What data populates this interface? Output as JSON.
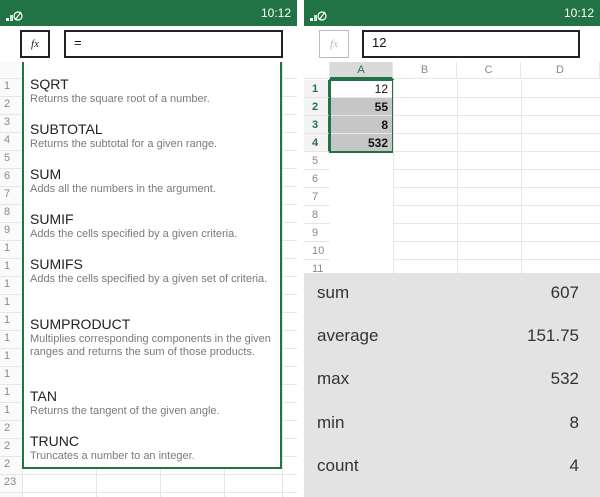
{
  "left": {
    "time": "10:12",
    "fx_label": "fx",
    "formula_value": "=",
    "row_numbers": [
      "1",
      "2",
      "3",
      "4",
      "5",
      "6",
      "7",
      "8",
      "9",
      "1",
      "1",
      "1",
      "1",
      "1",
      "1",
      "1",
      "1",
      "1",
      "1",
      "2",
      "2",
      "2",
      "23"
    ],
    "functions": [
      {
        "name": "SQRT",
        "description": "Returns the square root of a number."
      },
      {
        "name": "SUBTOTAL",
        "description": "Returns the subtotal for a given range."
      },
      {
        "name": "SUM",
        "description": "Adds all the numbers in the argument."
      },
      {
        "name": "SUMIF",
        "description": "Adds the cells specified by a given criteria."
      },
      {
        "name": "SUMIFS",
        "description": "Adds the cells specified by a given set of criteria."
      },
      {
        "name": "SUMPRODUCT",
        "description": "Multiplies corresponding components in the given ranges and returns the sum of those products."
      },
      {
        "name": "TAN",
        "description": "Returns the tangent of the given angle."
      },
      {
        "name": "TRUNC",
        "description": "Truncates a number to an integer."
      }
    ]
  },
  "right": {
    "time": "10:12",
    "fx_label": "fx",
    "formula_value": "12",
    "columns": [
      "A",
      "B",
      "C",
      "D"
    ],
    "rows": [
      "1",
      "2",
      "3",
      "4",
      "5",
      "6",
      "7",
      "8",
      "9",
      "10",
      "11"
    ],
    "column_a_values": [
      "12",
      "55",
      "8",
      "532"
    ],
    "summary": [
      {
        "label": "sum",
        "value": "607"
      },
      {
        "label": "average",
        "value": "151.75"
      },
      {
        "label": "max",
        "value": "532"
      },
      {
        "label": "min",
        "value": "8"
      },
      {
        "label": "count",
        "value": "4"
      }
    ]
  },
  "colors": {
    "excel_green": "#217346",
    "summary_bg": "#e3e3e3",
    "selection_fill": "#c6c6c6"
  }
}
